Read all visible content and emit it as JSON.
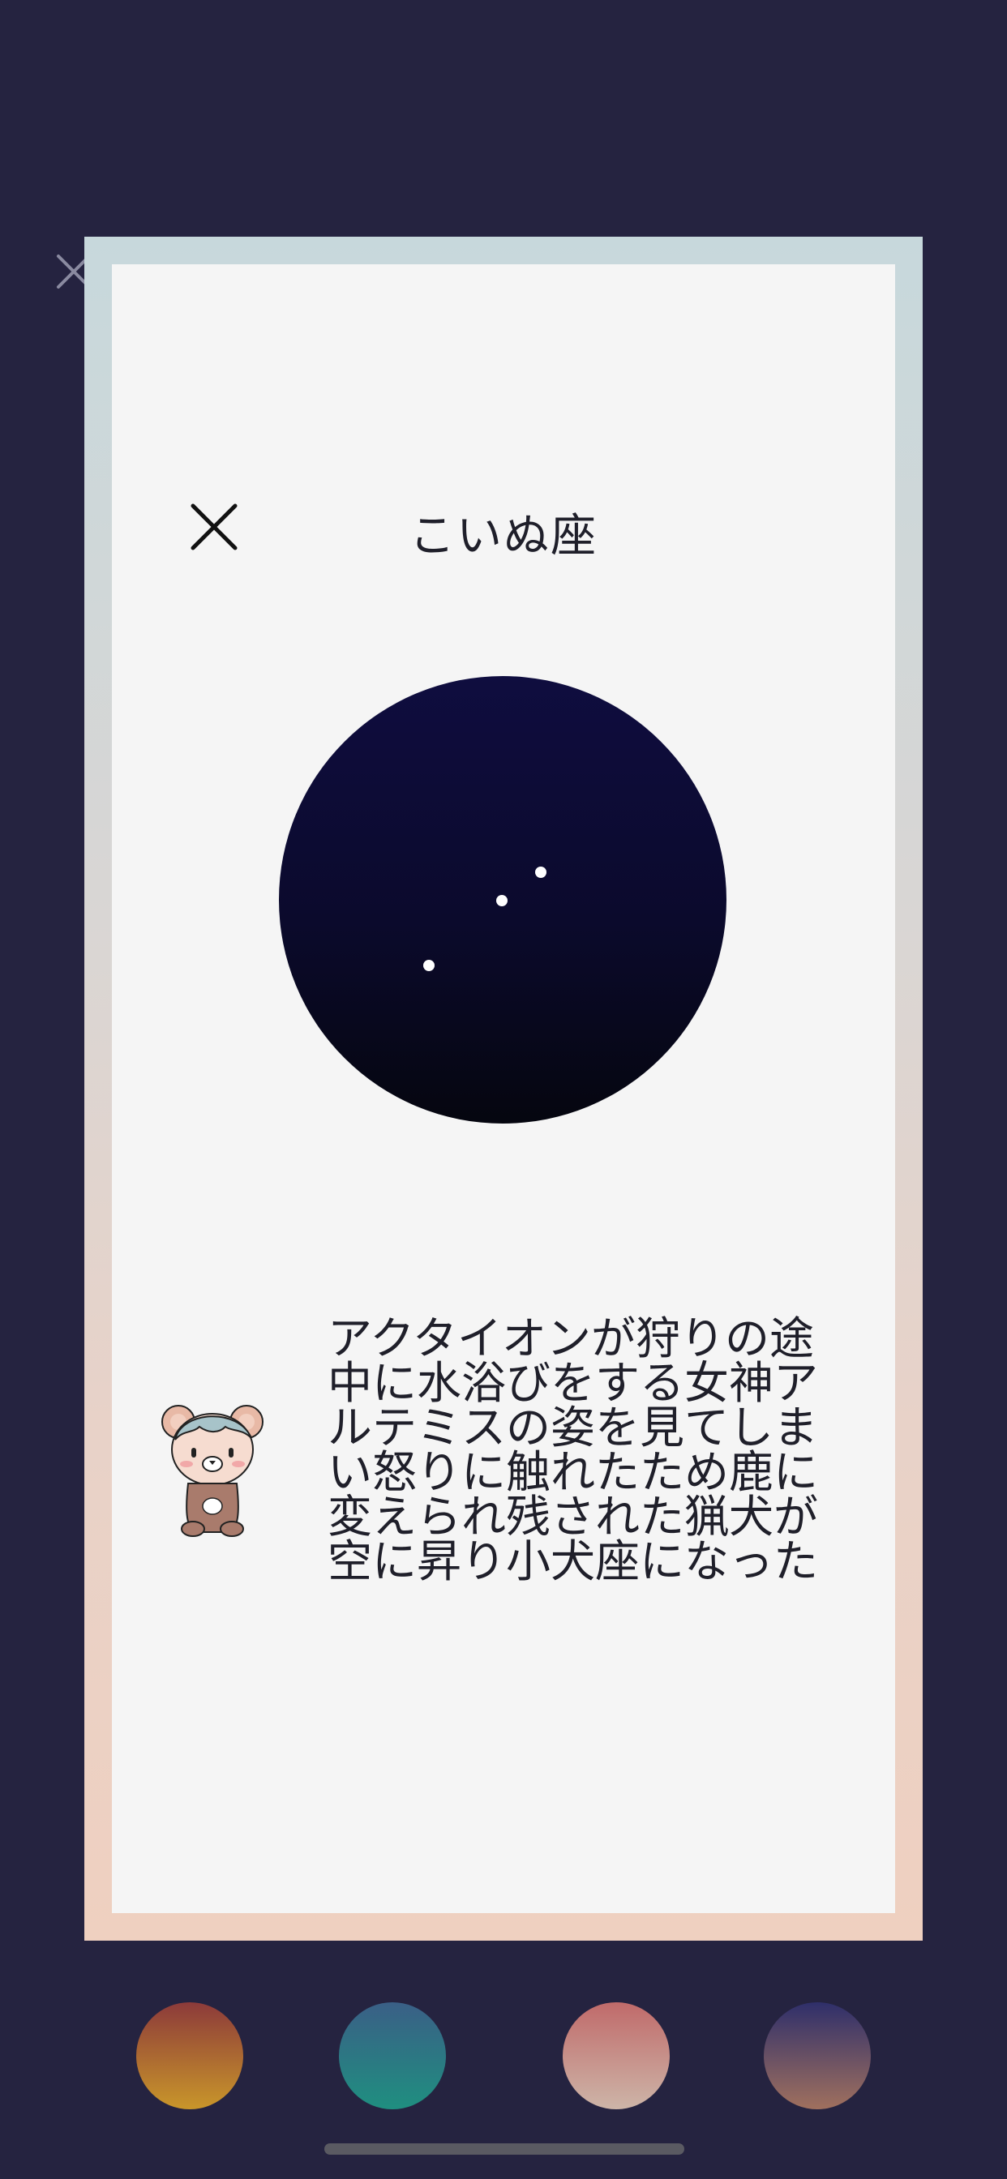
{
  "card": {
    "title": "こいぬ座",
    "story_lines": [
      "アクタイオンが狩りの途",
      "中に水浴びをする女神ア",
      "ルテミスの姿を見てしま",
      "い怒りに触れたため鹿に",
      "変えられ残された猟犬が",
      "空に昇り小犬座になった"
    ]
  },
  "icons": {
    "background_close": "close-icon",
    "card_close": "close-icon",
    "mascot": "bear-character-icon"
  },
  "colors": {
    "background": "#252340",
    "card_surface": "#f5f5f5",
    "sky_top": "#0f0d3f",
    "sky_bottom": "#05060f",
    "star": "#ffffff"
  },
  "color_swatches": [
    {
      "name": "sunset",
      "top": "#8c3a3a",
      "bottom": "#c9962a"
    },
    {
      "name": "ocean",
      "top": "#3a5f86",
      "bottom": "#1f8f80"
    },
    {
      "name": "blush",
      "top": "#c06a6a",
      "bottom": "#cdb5a8"
    },
    {
      "name": "dusk",
      "top": "#2f2f6a",
      "bottom": "#a0705e"
    }
  ]
}
